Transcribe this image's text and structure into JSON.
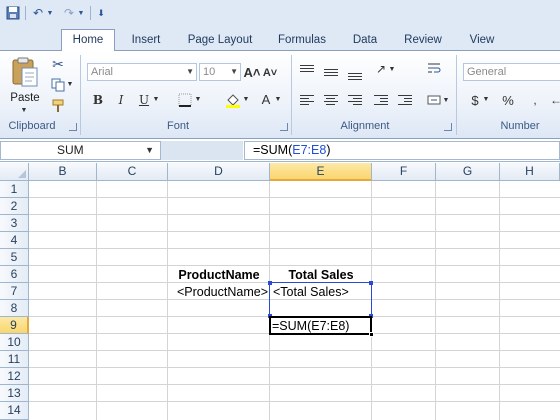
{
  "ribbon": {
    "tabs": [
      "Home",
      "Insert",
      "Page Layout",
      "Formulas",
      "Data",
      "Review",
      "View"
    ],
    "active_tab": "Home",
    "clipboard": {
      "paste_label": "Paste",
      "group_label": "Clipboard"
    },
    "font": {
      "font_name": "Arial",
      "font_size": "10",
      "group_label": "Font"
    },
    "alignment": {
      "group_label": "Alignment"
    },
    "number": {
      "format": "General",
      "currency_symbol": "$",
      "percent_symbol": "%",
      "group_label": "Number"
    }
  },
  "formula_bar": {
    "name_box": "SUM",
    "formula_prefix": "=SUM(",
    "formula_ref": "E7:E8",
    "formula_suffix": ")"
  },
  "grid": {
    "columns": [
      "B",
      "C",
      "D",
      "E",
      "F",
      "G",
      "H"
    ],
    "selected_column": "E",
    "rows": [
      "1",
      "2",
      "3",
      "4",
      "5",
      "6",
      "7",
      "8",
      "9",
      "10",
      "11",
      "12",
      "13",
      "14"
    ],
    "selected_row": "9"
  },
  "cells": {
    "D6": "ProductName",
    "E6": "Total Sales",
    "D7": "<ProductName>",
    "E7": "<Total Sales>",
    "E9": "=SUM(E7:E8)"
  },
  "colors": {
    "ribbon_bg": "#dfe8f5",
    "selected_header": "#f9d66e",
    "range_border": "#2a4ad6"
  }
}
